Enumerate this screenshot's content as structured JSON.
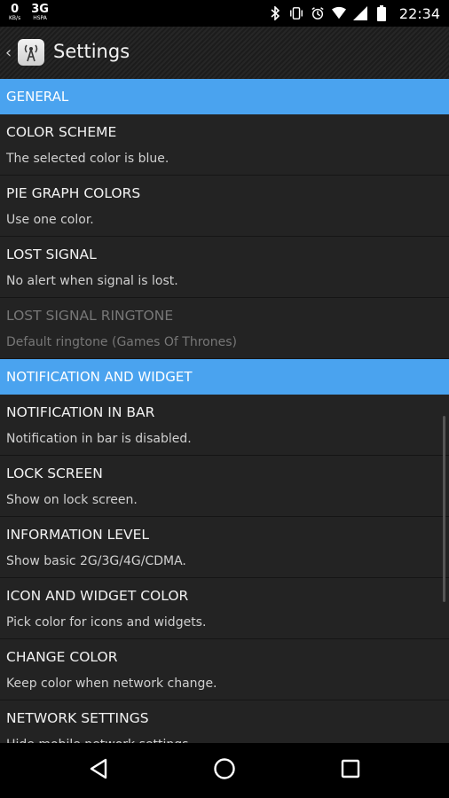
{
  "status_bar": {
    "left": [
      {
        "value": "0",
        "unit": "KB/s"
      },
      {
        "value": "3G",
        "unit": "HSPA"
      }
    ],
    "time": "22:34",
    "icons": [
      "bluetooth-icon",
      "vibrate-icon",
      "alarm-icon",
      "wifi-icon",
      "signal-icon",
      "battery-icon"
    ]
  },
  "action_bar": {
    "title": "Settings",
    "back_icon": "chevron-left-icon",
    "app_icon": "radio-tower-icon"
  },
  "sections": {
    "general": {
      "header": "GENERAL",
      "items": [
        {
          "title": "COLOR SCHEME",
          "summary": "The selected color is blue."
        },
        {
          "title": "PIE GRAPH COLORS",
          "summary": "Use one color."
        },
        {
          "title": "LOST SIGNAL",
          "summary": "No alert when signal is lost."
        },
        {
          "title": "LOST SIGNAL RINGTONE",
          "summary": "Default ringtone (Games Of Thrones)",
          "disabled": true
        }
      ]
    },
    "notification": {
      "header": "NOTIFICATION AND WIDGET",
      "items": [
        {
          "title": "NOTIFICATION IN BAR",
          "summary": "Notification in bar is disabled."
        },
        {
          "title": "LOCK SCREEN",
          "summary": "Show on lock screen."
        },
        {
          "title": "INFORMATION LEVEL",
          "summary": "Show basic 2G/3G/4G/CDMA."
        },
        {
          "title": "ICON AND WIDGET COLOR",
          "summary": "Pick color for icons and widgets."
        },
        {
          "title": "CHANGE COLOR",
          "summary": "Keep color when network change."
        },
        {
          "title": "NETWORK SETTINGS",
          "summary": "Hide mobile network settings."
        }
      ]
    }
  },
  "colors": {
    "accent": "#4aa3ef",
    "background": "#232323",
    "disabled_text": "#777777"
  },
  "nav_bar": {
    "icons": [
      "back-triangle-icon",
      "home-circle-icon",
      "recents-square-icon"
    ]
  }
}
